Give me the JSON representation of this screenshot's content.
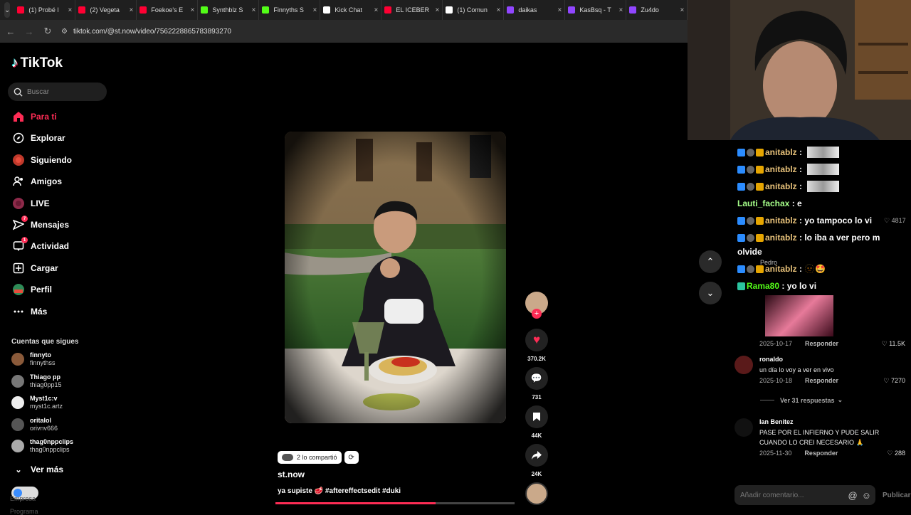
{
  "browser": {
    "tabs": [
      {
        "title": "(1) Probé l",
        "color": "#ff0033"
      },
      {
        "title": "(2) Vegeta",
        "color": "#ff0033"
      },
      {
        "title": "Foekoe's E",
        "color": "#ff0033"
      },
      {
        "title": "Synthblz S",
        "color": "#53fc18"
      },
      {
        "title": "Finnyths S",
        "color": "#53fc18"
      },
      {
        "title": "Kick Chat",
        "color": "#ffffff"
      },
      {
        "title": "EL ICEBER",
        "color": "#ff0033"
      },
      {
        "title": "(1) Comun",
        "color": "#ffffff"
      },
      {
        "title": "daikas",
        "color": "#9146ff"
      },
      {
        "title": "KasBsq - T",
        "color": "#9146ff"
      },
      {
        "title": "Zu4do",
        "color": "#9146ff"
      }
    ],
    "url": "tiktok.com/@st.now/video/7562228865783893270"
  },
  "sidebar": {
    "logo": "TikTok",
    "search_placeholder": "Buscar",
    "nav": [
      {
        "label": "Para ti",
        "icon": "home-icon",
        "active": true
      },
      {
        "label": "Explorar",
        "icon": "compass-icon"
      },
      {
        "label": "Siguiendo",
        "icon": "following-icon"
      },
      {
        "label": "Amigos",
        "icon": "friends-icon"
      },
      {
        "label": "LIVE",
        "icon": "live-icon"
      },
      {
        "label": "Mensajes",
        "icon": "messages-icon",
        "badge": "7"
      },
      {
        "label": "Actividad",
        "icon": "activity-icon",
        "badge": "1"
      },
      {
        "label": "Cargar",
        "icon": "upload-icon"
      },
      {
        "label": "Perfil",
        "icon": "profile-icon"
      },
      {
        "label": "Más",
        "icon": "more-icon"
      }
    ],
    "following_title": "Cuentas que sigues",
    "following": [
      {
        "name": "finnyto",
        "handle": "finnythss",
        "color": "#8a5a3a"
      },
      {
        "name": "Thiago pp",
        "handle": "thiag0pp15",
        "color": "#777"
      },
      {
        "name": "Myst1c:v",
        "handle": "myst1c.artz",
        "color": "#eee"
      },
      {
        "name": "oritalol",
        "handle": "orivnv666",
        "color": "#555"
      },
      {
        "name": "thag0nppclips",
        "handle": "thag0nppclips",
        "color": "#aaa"
      }
    ],
    "see_more": "Ver más",
    "footer_label_1": "Empresa",
    "footer_label_2": "Programa"
  },
  "video": {
    "shared_by": "2 lo compartió",
    "author": "st.now",
    "caption": "ya supiste 🥩 #aftereffectsedit #duki",
    "progress": 0.67,
    "likes": "370.2K",
    "comments": "731",
    "saves": "44K",
    "shares": "24K"
  },
  "chat": {
    "messages": [
      {
        "user": "anitablz",
        "text": "",
        "has_image": true
      },
      {
        "user": "anitablz",
        "text": "",
        "has_image": true
      },
      {
        "user": "anitablz",
        "text": "",
        "has_image": true
      },
      {
        "user": "Lauti_fachax",
        "text": "e",
        "color": "#a6ff8a"
      },
      {
        "user": "anitablz",
        "text": "yo tampoco lo vi"
      },
      {
        "user": "anitablz",
        "text": "lo iba a ver pero m"
      },
      {
        "user": "",
        "text": "olvide"
      },
      {
        "user": "anitablz",
        "text": "🫥🤩"
      },
      {
        "user": "Rama80",
        "text": "yo lo vi",
        "color": "#53fc18"
      }
    ],
    "overlay_count": "4817",
    "overlay_name": "Pedro"
  },
  "comments": [
    {
      "user": "",
      "text": "",
      "date": "2025-10-17",
      "reply": "Responder",
      "likes": "11.5K",
      "has_image": true
    },
    {
      "user": "ronaldo",
      "text": "un día lo voy a ver en vivo",
      "date": "2025-10-18",
      "reply": "Responder",
      "likes": "7270"
    },
    {
      "user": "Ian Benitez",
      "text": "PASE POR EL INFIERNO Y PUDE SALIR CUANDO LO CREI NECESARIO 🙏",
      "date": "2025-11-30",
      "reply": "Responder",
      "likes": "288"
    }
  ],
  "replies_toggle": "Ver 31 respuestas",
  "composer": {
    "placeholder": "Añadir comentario...",
    "publish": "Publicar"
  }
}
